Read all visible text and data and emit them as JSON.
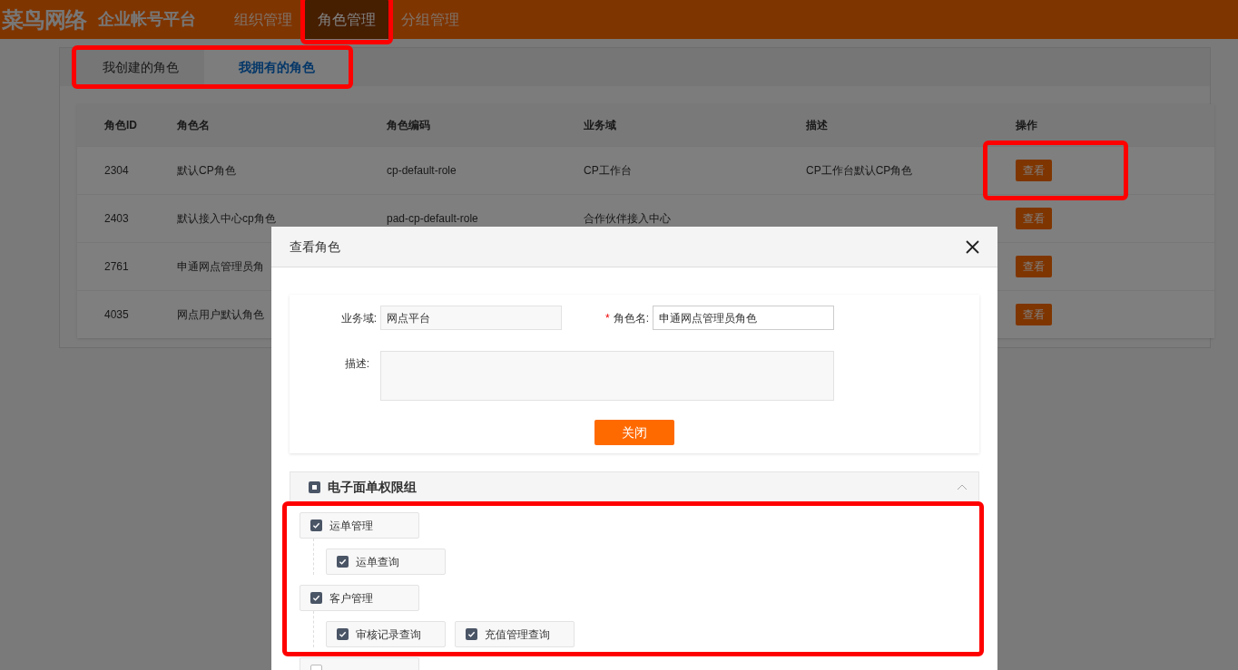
{
  "header": {
    "logo": "菜鸟网络",
    "platform": "企业帐号平台",
    "nav": [
      {
        "label": "组织管理",
        "selected": false,
        "highlighted": false
      },
      {
        "label": "角色管理",
        "selected": true,
        "highlighted": true
      },
      {
        "label": "分组管理",
        "selected": false,
        "highlighted": false
      }
    ]
  },
  "tabs": {
    "highlighted": true,
    "items": [
      {
        "label": "我创建的角色",
        "selected": false
      },
      {
        "label": "我拥有的角色",
        "selected": true
      }
    ]
  },
  "table": {
    "columns": [
      "角色ID",
      "角色名",
      "角色编码",
      "业务域",
      "描述",
      "操作"
    ],
    "rows": [
      {
        "cells": [
          "2304",
          "默认CP角色",
          "cp-default-role",
          "CP工作台",
          "CP工作台默认CP角色"
        ],
        "action": "查看",
        "highlighted": true
      },
      {
        "cells": [
          "2403",
          "默认接入中心cp角色",
          "pad-cp-default-role",
          "合作伙伴接入中心"
        ],
        "action": "查看",
        "highlighted": false
      },
      {
        "cells": [
          "2761",
          "申通网点管理员角"
        ],
        "action": "查看",
        "highlighted": false
      },
      {
        "cells": [
          "4035",
          "网点用户默认角色"
        ],
        "action": "查看",
        "highlighted": false
      }
    ]
  },
  "modal": {
    "title": "查看角色",
    "fields": [
      {
        "label": "业务域:",
        "value": "网点平台",
        "disabled": true
      },
      {
        "required_mark": "*",
        "label": "角色名:",
        "value": "申通网点管理员角色",
        "disabled": false
      }
    ],
    "description": {
      "label": "描述:"
    },
    "close_button": "关闭",
    "permission_group": {
      "title": "电子面单权限组",
      "indeterminate": true,
      "expanded": true,
      "highlighted": true,
      "items": [
        {
          "label": "运单管理",
          "checked": true,
          "children": [
            {
              "label": "运单查询",
              "checked": true
            }
          ]
        },
        {
          "label": "客户管理",
          "checked": true,
          "children": [
            {
              "label": "审核记录查询",
              "checked": true
            },
            {
              "label": "充值管理查询",
              "checked": true
            }
          ]
        },
        {
          "checked": false
        }
      ]
    }
  }
}
